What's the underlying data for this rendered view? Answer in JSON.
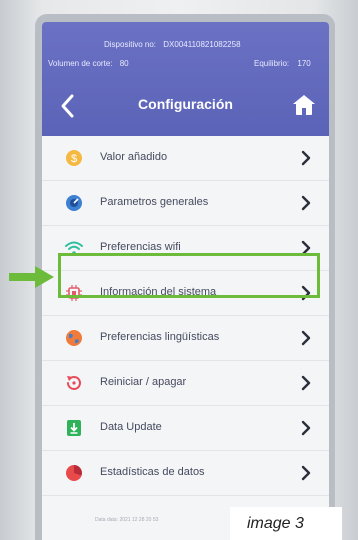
{
  "header": {
    "device_label": "Dispositivo no:",
    "device_id": "DX004110821082258",
    "cut_volume_label": "Volumen de corte:",
    "cut_volume_value": "80",
    "balance_label": "Equilibrio:",
    "balance_value": "170",
    "title": "Configuración"
  },
  "menu": {
    "items": [
      {
        "label": "Valor añadido",
        "icon": "coin-icon",
        "color": "#f5b942"
      },
      {
        "label": "Parametros generales",
        "icon": "gauge-icon",
        "color": "#3d7fd1"
      },
      {
        "label": "Preferencias wifi",
        "icon": "wifi-icon",
        "color": "#2fbf9e"
      },
      {
        "label": "Información del sistema",
        "icon": "chip-icon",
        "color": "#e55a6a"
      },
      {
        "label": "Preferencias lingüísticas",
        "icon": "globe-icon",
        "color": "#f07b3a"
      },
      {
        "label": "Reiniciar / apagar",
        "icon": "restart-icon",
        "color": "#e84a5a"
      },
      {
        "label": "Data Update",
        "icon": "download-icon",
        "color": "#2fb35a"
      },
      {
        "label": "Estadísticas de datos",
        "icon": "pie-chart-icon",
        "color": "#e84a4a"
      }
    ]
  },
  "footer": {
    "text": "Data data: 2021 12 28 20 53"
  },
  "caption": "image 3",
  "colors": {
    "header": "#5b63b8",
    "highlight": "#6dbb3a"
  }
}
